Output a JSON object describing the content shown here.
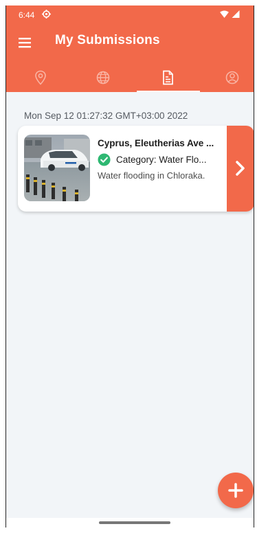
{
  "status_bar": {
    "time": "6:44",
    "icons": [
      "gear-icon",
      "wifi-icon",
      "signal-icon"
    ]
  },
  "app_bar": {
    "title": "My Submissions",
    "menu_icon": "hamburger-menu-icon",
    "color": "#f2694a"
  },
  "tabs": [
    {
      "icon": "location-pin-icon",
      "active": false
    },
    {
      "icon": "globe-icon",
      "active": false
    },
    {
      "icon": "document-icon",
      "active": true
    },
    {
      "icon": "profile-icon",
      "active": false
    }
  ],
  "submissions": [
    {
      "date": "Mon Sep 12 01:27:32 GMT+03:00 2022",
      "location": "Cyprus, Eleutherias Ave ...",
      "status_icon": "check-circle-icon",
      "status_color": "#2eb872",
      "category": "Category: Water Flo...",
      "description": "Water flooding in Chloraka.",
      "thumbnail_icon": "flooded-street-photo",
      "action_icon": "chevron-right-icon"
    }
  ],
  "fab": {
    "icon": "plus-icon"
  }
}
